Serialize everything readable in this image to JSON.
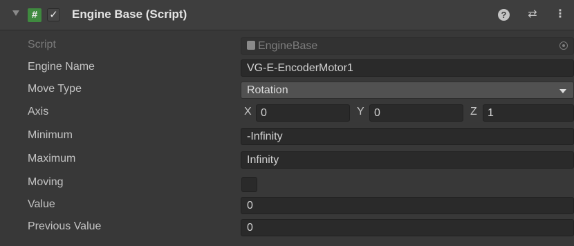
{
  "header": {
    "title": "Engine Base (Script)",
    "script_icon_glyph": "#",
    "enabled_glyph": "✓",
    "help_glyph": "?",
    "presets_glyph": "⇄",
    "menu_glyph": "⋮"
  },
  "fields": {
    "script": {
      "label": "Script",
      "value": "EngineBase"
    },
    "engine_name": {
      "label": "Engine Name",
      "value": "VG-E-EncoderMotor1"
    },
    "move_type": {
      "label": "Move Type",
      "value": "Rotation"
    },
    "axis": {
      "label": "Axis",
      "x_label": "X",
      "x_value": "0",
      "y_label": "Y",
      "y_value": "0",
      "z_label": "Z",
      "z_value": "1"
    },
    "minimum": {
      "label": "Minimum",
      "value": "-Infinity"
    },
    "maximum": {
      "label": "Maximum",
      "value": "Infinity"
    },
    "moving": {
      "label": "Moving",
      "checked": false
    },
    "value": {
      "label": "Value",
      "value": "0"
    },
    "previous_value": {
      "label": "Previous Value",
      "value": "0"
    }
  },
  "colors": {
    "background": "#383838",
    "header": "#3e3e3e",
    "field": "#2a2a2a",
    "script_icon": "#3f8a3f"
  }
}
